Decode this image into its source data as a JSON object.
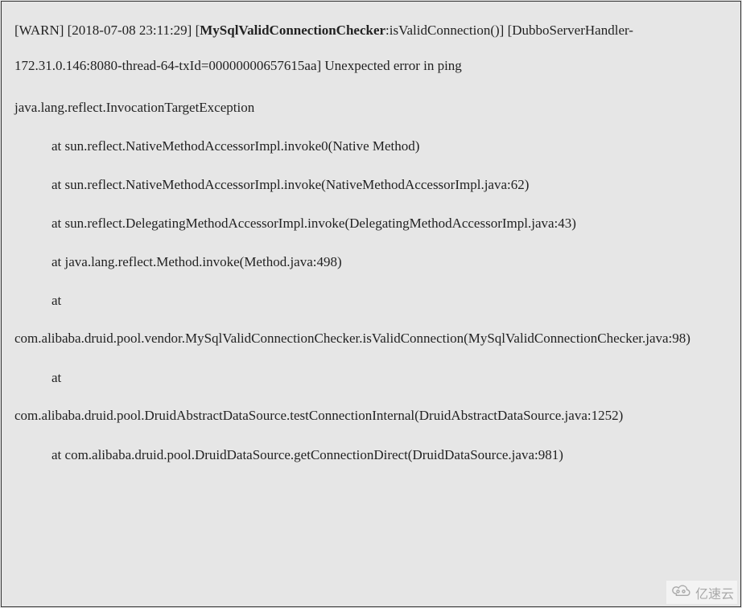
{
  "log": {
    "level_prefix": "[WARN] [2018-07-08 23:11:29] [",
    "bold_part": "MySqlValidConnectionChecker",
    "after_bold": ":isValidConnection()] [DubboServerHandler-172.31.0.146:8080-thread-64-txId=00000000657615aa] Unexpected error in ping",
    "exception": "java.lang.reflect.InvocationTargetException",
    "stack": [
      "at sun.reflect.NativeMethodAccessorImpl.invoke0(Native Method)",
      "at sun.reflect.NativeMethodAccessorImpl.invoke(NativeMethodAccessorImpl.java:62)",
      "at sun.reflect.DelegatingMethodAccessorImpl.invoke(DelegatingMethodAccessorImpl.java:43)",
      "at java.lang.reflect.Method.invoke(Method.java:498)"
    ],
    "at_alone_1": "at",
    "wrap_1": "com.alibaba.druid.pool.vendor.MySqlValidConnectionChecker.isValidConnection(MySqlValidConnectionChecker.java:98)",
    "at_alone_2": "at",
    "wrap_2": "com.alibaba.druid.pool.DruidAbstractDataSource.testConnectionInternal(DruidAbstractDataSource.java:1252)",
    "stack_last": "at com.alibaba.druid.pool.DruidDataSource.getConnectionDirect(DruidDataSource.java:981)"
  },
  "watermark": {
    "text": "亿速云"
  }
}
